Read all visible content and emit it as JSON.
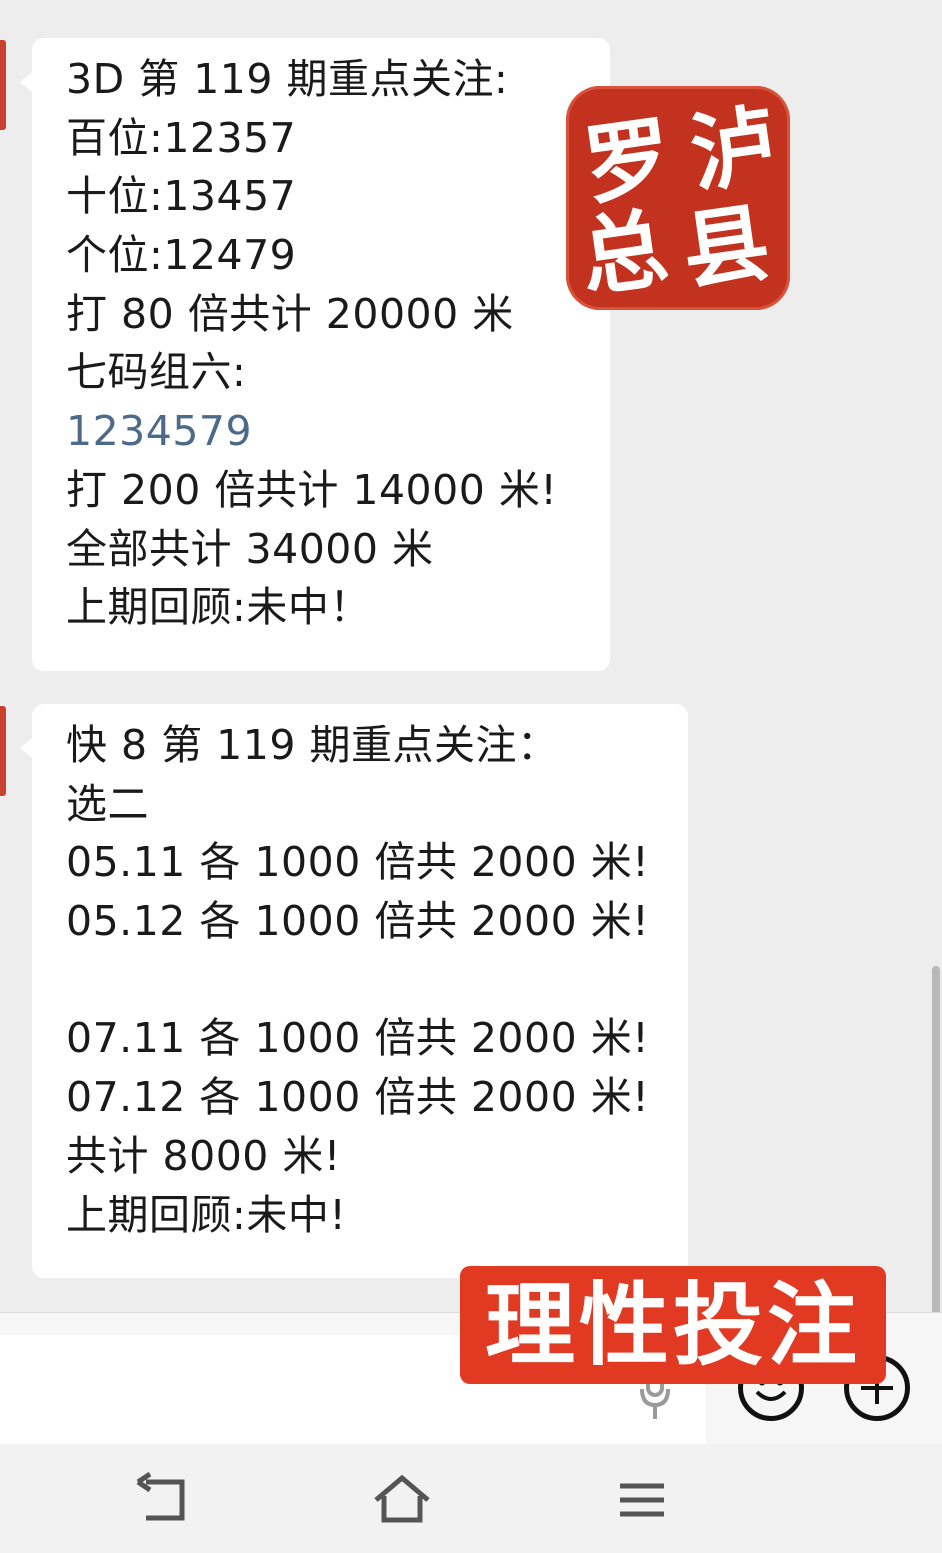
{
  "messages": [
    {
      "lines": [
        "3D 第 119 期重点关注:",
        "百位:12357",
        "十位:13457",
        "个位:12479",
        "打 80 倍共计 20000 米",
        "七码组六:",
        "1234579",
        "打 200 倍共计 14000 米!",
        "全部共计 34000 米",
        "上期回顾:未中！"
      ]
    },
    {
      "lines": [
        "快 8 第 119 期重点关注：",
        "选二",
        "05.11 各 1000 倍共 2000 米!",
        "05.12 各 1000 倍共 2000 米!",
        "",
        "07.11 各 1000 倍共 2000 米!",
        "07.12 各 1000 倍共 2000 米!",
        "共计 8000 米!",
        "上期回顾:未中!"
      ]
    }
  ],
  "seal": {
    "chars": [
      "泸",
      "县",
      "罗",
      "总"
    ]
  },
  "banner": {
    "text": "理性投注"
  },
  "input_bar": {
    "icons": [
      "microphone-icon",
      "emoji-icon",
      "plus-icon"
    ]
  },
  "navbar": {
    "icons": [
      "back-icon",
      "home-icon",
      "menu-icon"
    ]
  },
  "colors": {
    "background": "#ededed",
    "bubble": "#ffffff",
    "seal": "#c2321e",
    "banner": "#e23a22",
    "link_text": "#4d6a89"
  }
}
